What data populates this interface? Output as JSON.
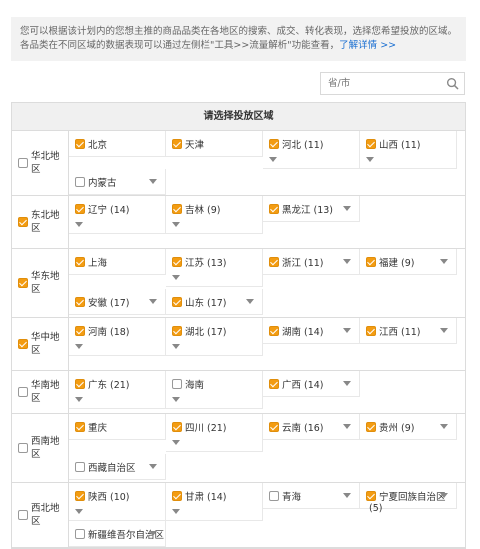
{
  "notice": {
    "text": "您可以根据该计划内的您想主推的商品品类在各地区的搜索、成交、转化表现，选择您希望投放的区域。各品类在不同区域的数据表现可以通过左侧栏\"工具>>流量解析\"功能查看，",
    "link": "了解详情 >>"
  },
  "search": {
    "placeholder": "省/市",
    "icon": "search-icon"
  },
  "table": {
    "title": "请选择投放区域",
    "regions": [
      {
        "name": "华北地区",
        "checked": false,
        "provinces": [
          {
            "name": "北京",
            "checked": true,
            "count": "",
            "caret": false
          },
          {
            "name": "天津",
            "checked": true,
            "count": "",
            "caret": false
          },
          {
            "name": "河北",
            "checked": true,
            "count": "(11)",
            "caret": true
          },
          {
            "name": "山西",
            "checked": true,
            "count": "(11)",
            "caret": true
          },
          {
            "name": "内蒙古",
            "checked": false,
            "count": "",
            "caret": true
          }
        ]
      },
      {
        "name": "东北地区",
        "checked": true,
        "provinces": [
          {
            "name": "辽宁",
            "checked": true,
            "count": "(14)",
            "caret": true
          },
          {
            "name": "吉林",
            "checked": true,
            "count": "(9)",
            "caret": true
          },
          {
            "name": "黑龙江",
            "checked": true,
            "count": "(13)",
            "caret": true
          }
        ]
      },
      {
        "name": "华东地区",
        "checked": true,
        "provinces": [
          {
            "name": "上海",
            "checked": true,
            "count": "",
            "caret": false
          },
          {
            "name": "江苏",
            "checked": true,
            "count": "(13)",
            "caret": true
          },
          {
            "name": "浙江",
            "checked": true,
            "count": "(11)",
            "caret": true
          },
          {
            "name": "福建",
            "checked": true,
            "count": "(9)",
            "caret": true
          },
          {
            "name": "安徽",
            "checked": true,
            "count": "(17)",
            "caret": true
          },
          {
            "name": "山东",
            "checked": true,
            "count": "(17)",
            "caret": true
          }
        ]
      },
      {
        "name": "华中地区",
        "checked": true,
        "provinces": [
          {
            "name": "河南",
            "checked": true,
            "count": "(18)",
            "caret": true
          },
          {
            "name": "湖北",
            "checked": true,
            "count": "(17)",
            "caret": true
          },
          {
            "name": "湖南",
            "checked": true,
            "count": "(14)",
            "caret": true
          },
          {
            "name": "江西",
            "checked": true,
            "count": "(11)",
            "caret": true
          }
        ]
      },
      {
        "name": "华南地区",
        "checked": false,
        "provinces": [
          {
            "name": "广东",
            "checked": true,
            "count": "(21)",
            "caret": true
          },
          {
            "name": "海南",
            "checked": false,
            "count": "",
            "caret": true
          },
          {
            "name": "广西",
            "checked": true,
            "count": "(14)",
            "caret": true
          }
        ]
      },
      {
        "name": "西南地区",
        "checked": false,
        "provinces": [
          {
            "name": "重庆",
            "checked": true,
            "count": "",
            "caret": false
          },
          {
            "name": "四川",
            "checked": true,
            "count": "(21)",
            "caret": true
          },
          {
            "name": "云南",
            "checked": true,
            "count": "(16)",
            "caret": true
          },
          {
            "name": "贵州",
            "checked": true,
            "count": "(9)",
            "caret": true
          },
          {
            "name": "西藏自治区",
            "checked": false,
            "count": "",
            "caret": true
          }
        ]
      },
      {
        "name": "西北地区",
        "checked": false,
        "provinces": [
          {
            "name": "陕西",
            "checked": true,
            "count": "(10)",
            "caret": true
          },
          {
            "name": "甘肃",
            "checked": true,
            "count": "(14)",
            "caret": true
          },
          {
            "name": "青海",
            "checked": false,
            "count": "",
            "caret": true
          },
          {
            "name": "宁夏回族自治区",
            "checked": true,
            "count": "(5)",
            "caret": true
          },
          {
            "name": "新疆维吾尔自治区",
            "checked": false,
            "count": "",
            "caret": true
          }
        ]
      }
    ]
  },
  "colors": {
    "accent": "#f39c12",
    "link": "#1a6fd1",
    "header_bg": "#f0f0f0"
  }
}
